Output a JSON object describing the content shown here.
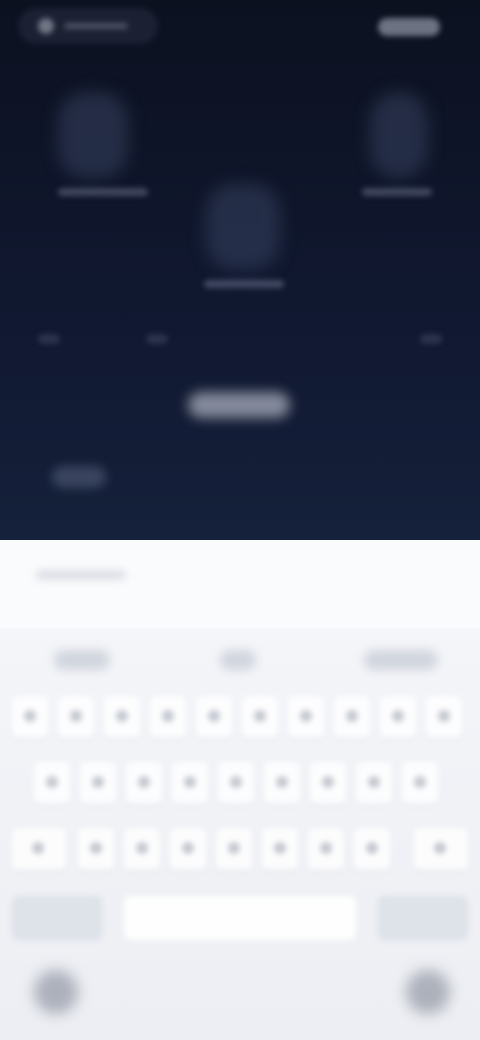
{
  "status_bar": {
    "left_icon": "status-pill-icon",
    "right_icon": "status-indicator-icon"
  },
  "blurred_content": {
    "tiles": [
      "tile-1",
      "tile-2",
      "tile-3"
    ],
    "center_button_label": "",
    "bottom_left_label": ""
  },
  "keyboard": {
    "input_hint": "",
    "suggestions": [
      "",
      "",
      ""
    ],
    "rows": [
      10,
      9,
      9
    ],
    "space_label": ""
  },
  "nav": {
    "left_icon": "globe-icon",
    "right_icon": "mic-icon"
  }
}
